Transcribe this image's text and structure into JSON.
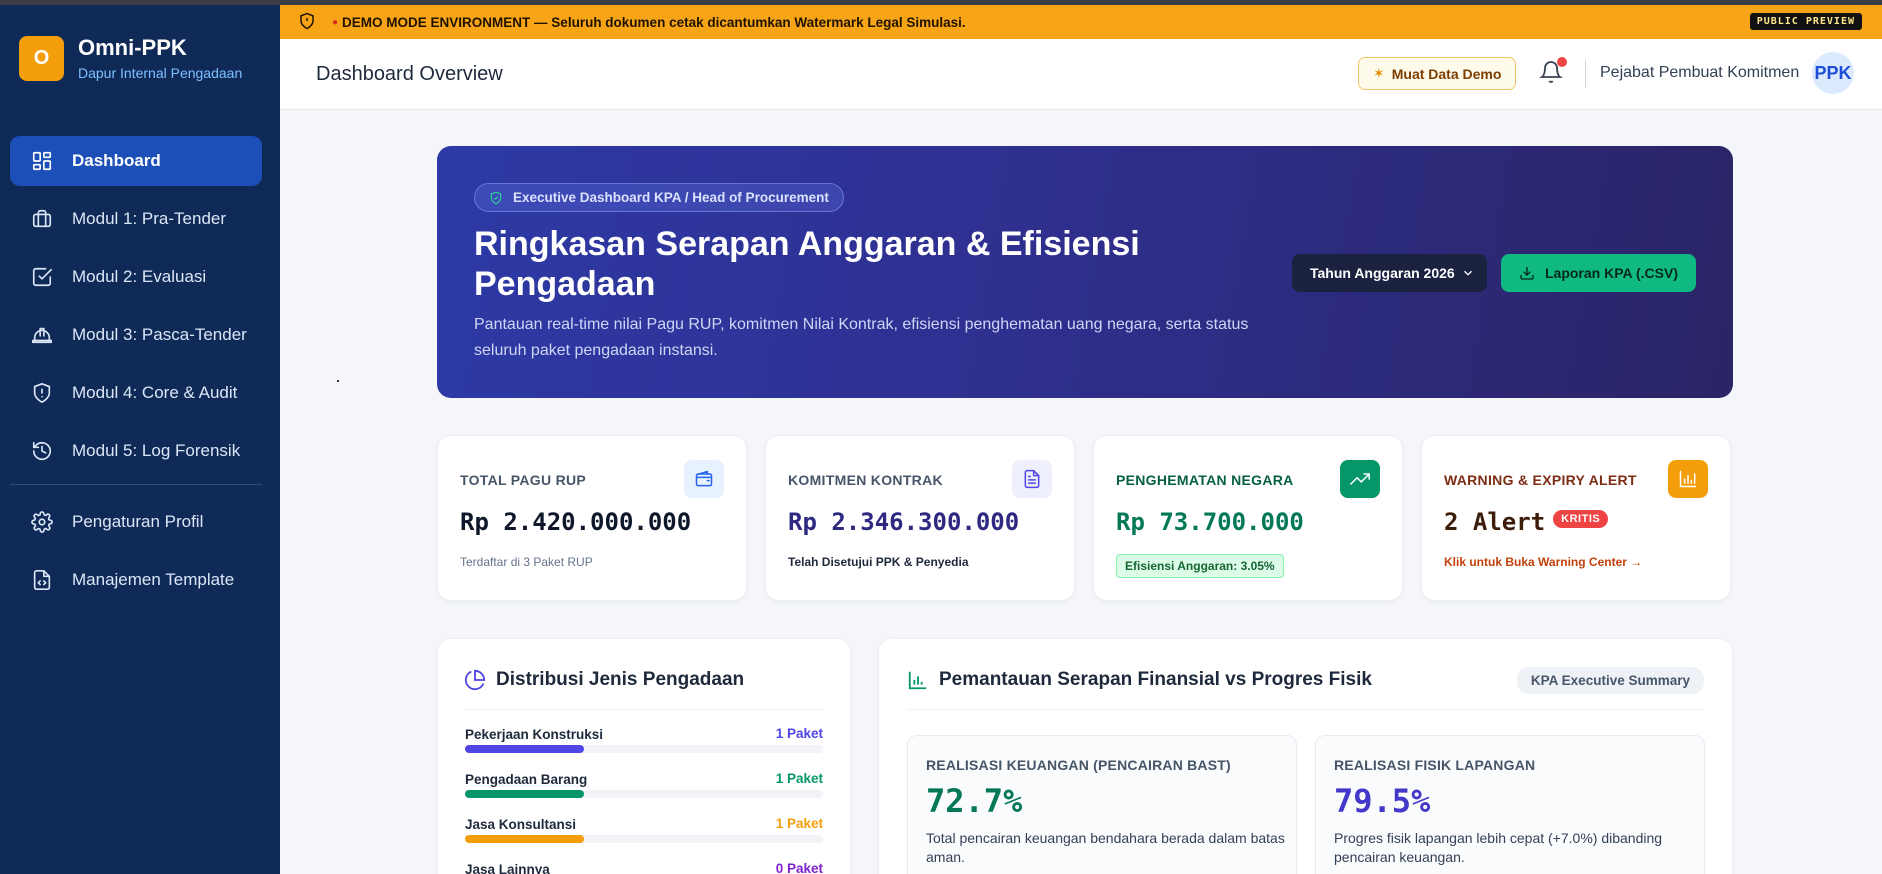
{
  "colors": {
    "sidebar_bg": "#0f2a57",
    "accent_blue": "#1d4fb8",
    "brand_orange": "#f59e0b",
    "demo_banner": "#f7a416",
    "success": "#10b981",
    "danger": "#ef4444"
  },
  "brand": {
    "logo_letter": "O",
    "name": "Omni-PPK",
    "subtitle": "Dapur Internal Pengadaan"
  },
  "sidebar": {
    "items": [
      {
        "label": "Dashboard",
        "icon": "grid-icon",
        "active": true
      },
      {
        "label": "Modul 1: Pra-Tender",
        "icon": "briefcase-icon",
        "active": false
      },
      {
        "label": "Modul 2: Evaluasi",
        "icon": "check-square-icon",
        "active": false
      },
      {
        "label": "Modul 3: Pasca-Tender",
        "icon": "hard-hat-icon",
        "active": false
      },
      {
        "label": "Modul 4: Core & Audit",
        "icon": "shield-alert-icon",
        "active": false
      },
      {
        "label": "Modul 5: Log Forensik",
        "icon": "history-icon",
        "active": false
      }
    ],
    "bottom_items": [
      {
        "label": "Pengaturan Profil",
        "icon": "gear-icon"
      },
      {
        "label": "Manajemen Template",
        "icon": "file-code-icon"
      }
    ]
  },
  "demo_banner": {
    "text": "DEMO MODE ENVIRONMENT — Seluruh dokumen cetak dicantumkan Watermark Legal Simulasi.",
    "badge": "PUBLIC PREVIEW"
  },
  "header": {
    "title": "Dashboard Overview",
    "demo_button": "Muat Data Demo",
    "user_role": "Pejabat Pembuat Komitmen",
    "avatar_initials": "PPK"
  },
  "hero": {
    "badge": "Executive Dashboard KPA / Head of Procurement",
    "title": "Ringkasan Serapan Anggaran & Efisiensi Pengadaan",
    "description": "Pantauan real-time nilai Pagu RUP, komitmen Nilai Kontrak, efisiensi penghematan uang negara, serta status seluruh paket pengadaan instansi.",
    "year_select": "Tahun Anggaran 2026",
    "csv_button": "Laporan KPA (.CSV)"
  },
  "stats": [
    {
      "label": "TOTAL PAGU RUP",
      "value": "Rp 2.420.000.000",
      "sub": "Terdaftar di 3 Paket RUP",
      "icon": "wallet-icon"
    },
    {
      "label": "KOMITMEN KONTRAK",
      "value": "Rp 2.346.300.000",
      "sub": "Telah Disetujui PPK & Penyedia",
      "icon": "document-icon"
    },
    {
      "label": "PENGHEMATAN NEGARA",
      "value": "Rp 73.700.000",
      "sub": "Efisiensi Anggaran: 3.05%",
      "icon": "trending-up-icon"
    },
    {
      "label": "WARNING & EXPIRY ALERT",
      "value": "2 Alert",
      "badge": "KRITIS",
      "sub": "Klik untuk Buka Warning Center →",
      "icon": "bar-chart-icon"
    }
  ],
  "distribution": {
    "title": "Distribusi Jenis Pengadaan",
    "items": [
      {
        "name": "Pekerjaan Konstruksi",
        "count": "1 Paket",
        "value": 1,
        "color": "#4f46e5"
      },
      {
        "name": "Pengadaan Barang",
        "count": "1 Paket",
        "value": 1,
        "color": "#059669"
      },
      {
        "name": "Jasa Konsultansi",
        "count": "1 Paket",
        "value": 1,
        "color": "#f59e0b"
      },
      {
        "name": "Jasa Lainnya",
        "count": "0 Paket",
        "value": 0,
        "color": "#7e22ce"
      }
    ],
    "max": 3
  },
  "monitoring": {
    "title": "Pemantauan Serapan Finansial vs Progres Fisik",
    "chip": "KPA Executive Summary",
    "finance": {
      "label": "REALISASI KEUANGAN (PENCAIRAN BAST)",
      "value": "72.7%",
      "desc": "Total pencairan keuangan bendahara berada dalam batas aman."
    },
    "physical": {
      "label": "REALISASI FISIK LAPANGAN",
      "value": "79.5%",
      "desc": "Progres fisik lapangan lebih cepat (+7.0%) dibanding pencairan keuangan."
    }
  }
}
